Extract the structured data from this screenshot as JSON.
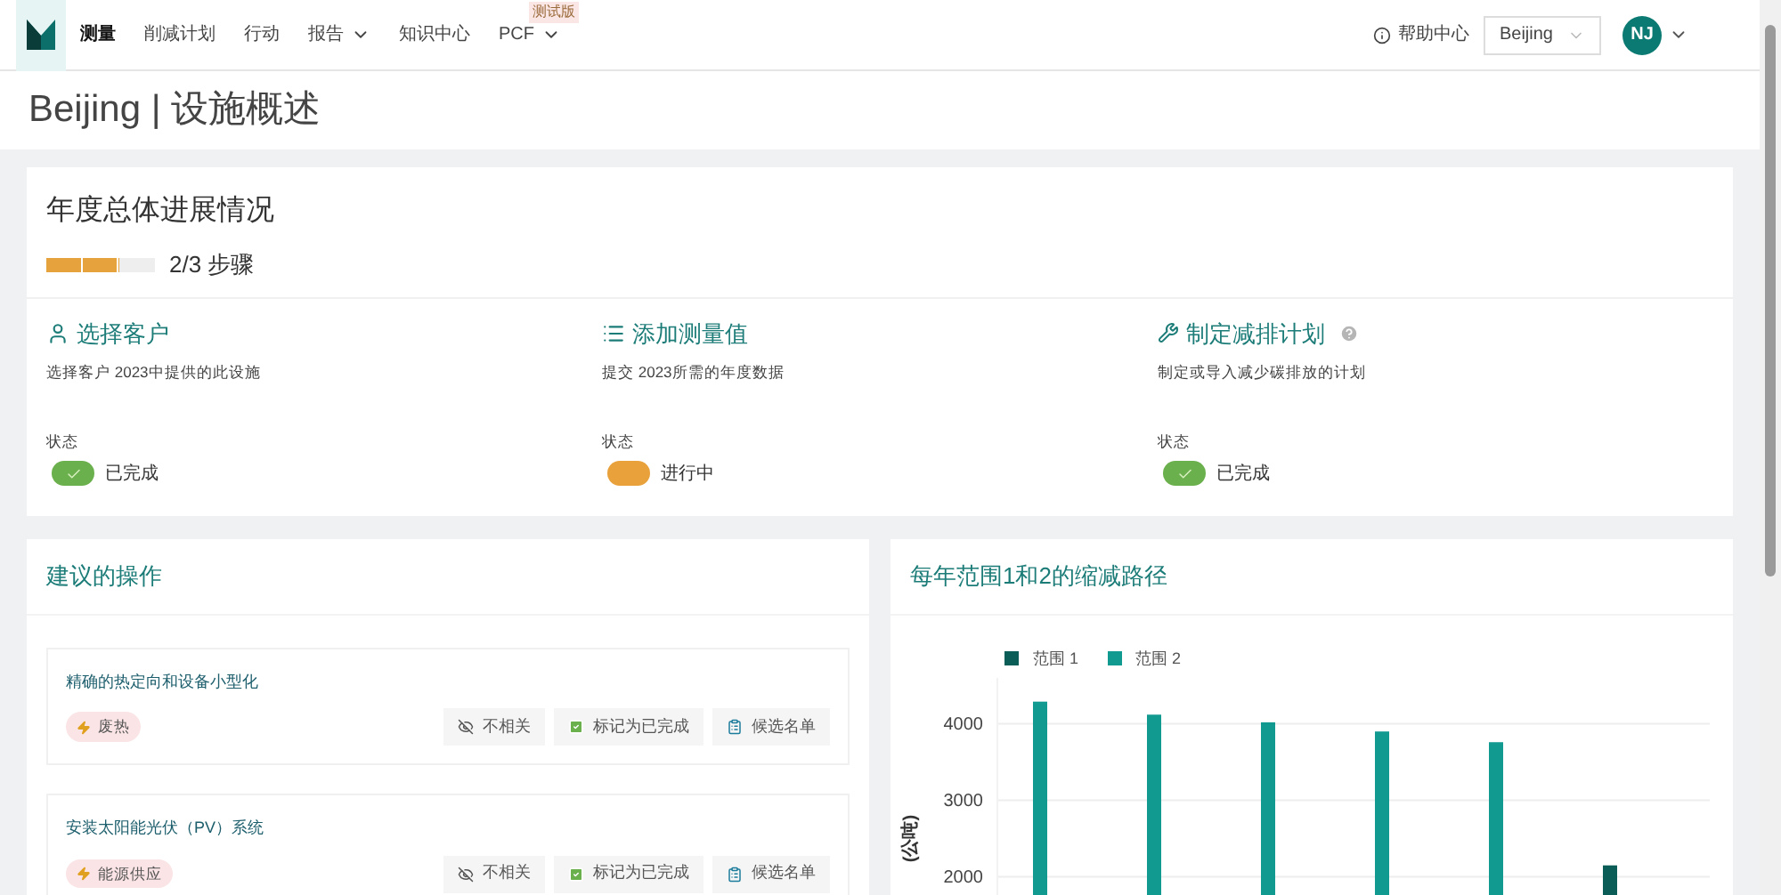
{
  "nav": {
    "items": [
      {
        "label": "测量",
        "selected": true,
        "dropdown": false
      },
      {
        "label": "削减计划",
        "selected": false,
        "dropdown": false
      },
      {
        "label": "行动",
        "selected": false,
        "dropdown": false
      },
      {
        "label": "报告",
        "selected": false,
        "dropdown": true
      },
      {
        "label": "知识中心",
        "selected": false,
        "dropdown": false
      },
      {
        "label": "PCF",
        "selected": false,
        "dropdown": true,
        "badge": "测试版"
      }
    ],
    "help": "帮助中心",
    "location": "Beijing",
    "avatar": "NJ"
  },
  "page_title": "Beijing | 设施概述",
  "progress": {
    "title": "年度总体进展情况",
    "level": 0.667,
    "reading": "2/3 步骤",
    "steps": [
      {
        "kind": "client",
        "title": "选择客户",
        "description": "选择客户 2023中提供的此设施",
        "status_label": "状态",
        "completed": true,
        "status_text": "已完成",
        "help": false
      },
      {
        "kind": "measure",
        "title": "添加测量值",
        "description": "提交 2023所需的年度数据",
        "status_label": "状态",
        "completed": false,
        "status_text": "进行中",
        "help": false
      },
      {
        "kind": "plan",
        "title": "制定减排计划",
        "description": "制定或导入减少碳排放的计划",
        "status_label": "状态",
        "completed": true,
        "status_text": "已完成",
        "help": true
      }
    ]
  },
  "actions": {
    "title": "建议的操作",
    "items": [
      {
        "title": "精确的热定向和设备小型化",
        "tag": "废热",
        "buttons": [
          "不相关",
          "标记为已完成",
          "候选名单"
        ]
      },
      {
        "title": "安装太阳能光伏（PV）系统",
        "tag": "能源供应",
        "buttons": [
          "不相关",
          "标记为已完成",
          "候选名单"
        ]
      }
    ]
  },
  "pathway": {
    "title": "每年范围1和2的缩减路径",
    "chart_data": {
      "type": "bar",
      "ylabel": "(公吨)",
      "ylim": [
        1600,
        4600
      ],
      "yticks": [
        2000,
        3000,
        4000
      ],
      "grid": true,
      "legend": "top",
      "series": [
        {
          "name": "范围 1",
          "color": "#0b5e58",
          "values": [
            null,
            null,
            null,
            null,
            null,
            2150
          ]
        },
        {
          "name": "范围 2",
          "color": "#119a8f",
          "values": [
            4290,
            4120,
            4020,
            3900,
            3760,
            null
          ]
        }
      ]
    }
  }
}
